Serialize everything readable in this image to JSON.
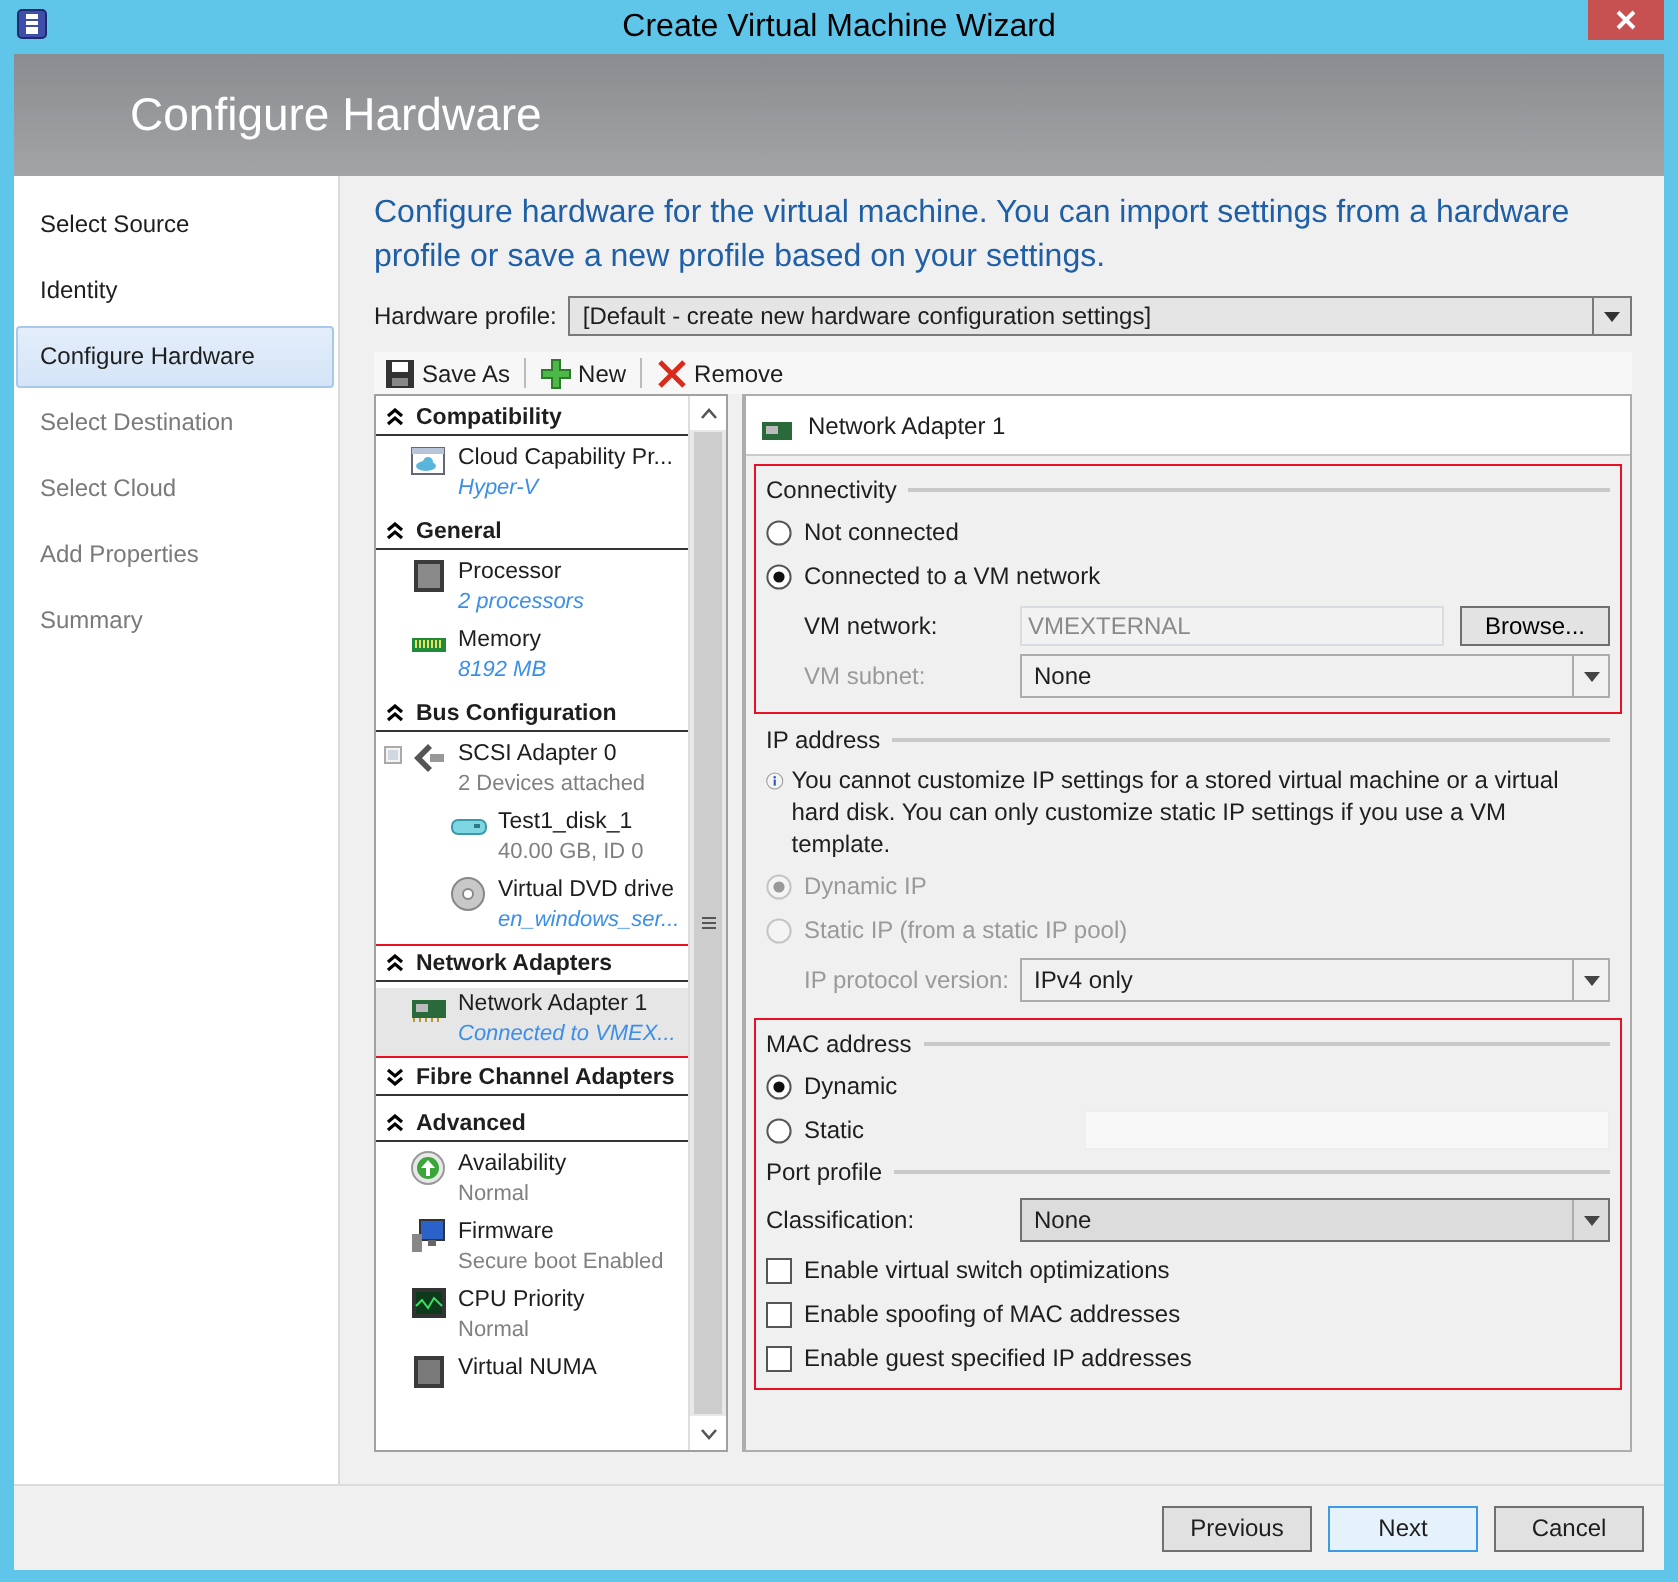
{
  "window": {
    "title": "Create Virtual Machine Wizard"
  },
  "header": {
    "title": "Configure Hardware"
  },
  "nav": {
    "items": [
      {
        "label": "Select Source",
        "selected": false,
        "disabled": false
      },
      {
        "label": "Identity",
        "selected": false,
        "disabled": false
      },
      {
        "label": "Configure Hardware",
        "selected": true,
        "disabled": false
      },
      {
        "label": "Select Destination",
        "selected": false,
        "disabled": true
      },
      {
        "label": "Select Cloud",
        "selected": false,
        "disabled": true
      },
      {
        "label": "Add Properties",
        "selected": false,
        "disabled": true
      },
      {
        "label": "Summary",
        "selected": false,
        "disabled": true
      }
    ]
  },
  "description": "Configure hardware for the virtual machine. You can import settings from a hardware profile or save a new profile based on your settings.",
  "hardware_profile": {
    "label": "Hardware profile:",
    "value": "[Default - create new hardware configuration settings]"
  },
  "toolbar": [
    {
      "kind": "save",
      "label": "Save As"
    },
    {
      "kind": "new",
      "label": "New"
    },
    {
      "kind": "remove",
      "label": "Remove"
    }
  ],
  "hardware_list": {
    "groups": [
      {
        "title": "Compatibility",
        "expanded": true,
        "items": [
          {
            "kind": "cloud",
            "name": "Cloud Capability Pr...",
            "detail": "Hyper-V",
            "detail_dim": false,
            "selected": false
          }
        ]
      },
      {
        "title": "General",
        "expanded": true,
        "items": [
          {
            "kind": "processor",
            "name": "Processor",
            "detail": "2 processors",
            "detail_dim": false,
            "selected": false
          },
          {
            "kind": "memory",
            "name": "Memory",
            "detail": "8192 MB",
            "detail_dim": false,
            "selected": false
          }
        ]
      },
      {
        "title": "Bus Configuration",
        "expanded": true,
        "items": [
          {
            "kind": "scsi",
            "name": "SCSI Adapter 0",
            "detail": "2 Devices attached",
            "detail_dim": true,
            "selected": false,
            "expanded": true,
            "children": [
              {
                "kind": "disk",
                "name": "Test1_disk_1",
                "detail": "40.00 GB, ID 0",
                "detail_dim": true,
                "selected": false
              },
              {
                "kind": "dvd",
                "name": "Virtual DVD drive",
                "detail": "en_windows_ser...",
                "detail_dim": false,
                "selected": false
              }
            ]
          }
        ]
      },
      {
        "title": "Network Adapters",
        "expanded": true,
        "highlighted": true,
        "items": [
          {
            "kind": "network",
            "name": "Network Adapter 1",
            "detail": "Connected to VMEX...",
            "detail_dim": false,
            "selected": true
          }
        ]
      },
      {
        "title": "Fibre Channel Adapters",
        "expanded": false
      },
      {
        "title": "Advanced",
        "expanded": true,
        "items": [
          {
            "kind": "availability",
            "name": "Availability",
            "detail": "Normal",
            "detail_dim": true,
            "selected": false
          },
          {
            "kind": "firmware",
            "name": "Firmware",
            "detail": "Secure boot Enabled",
            "detail_dim": true,
            "selected": false
          },
          {
            "kind": "cpu",
            "name": "CPU Priority",
            "detail": "Normal",
            "detail_dim": true,
            "selected": false
          },
          {
            "kind": "numa",
            "name": "Virtual NUMA",
            "selected": false
          }
        ]
      }
    ]
  },
  "panel": {
    "title": "Network Adapter 1",
    "blocks": [
      {
        "highlighted": true,
        "sections": [
          {
            "title": "Connectivity",
            "rows": [
              {
                "kind": "radio",
                "label": "Not connected",
                "selected": false,
                "disabled": false
              },
              {
                "kind": "radio",
                "label": "Connected to a VM network",
                "selected": true,
                "disabled": false
              },
              {
                "kind": "text",
                "label": "VM network:",
                "value": "VMEXTERNAL",
                "value_disabled": true,
                "button": "Browse..."
              },
              {
                "kind": "select",
                "label": "VM subnet:",
                "label_disabled": true,
                "value": "None"
              }
            ]
          }
        ]
      },
      {
        "sections": [
          {
            "title": "IP address",
            "rows": [
              {
                "kind": "info",
                "text": "You cannot customize IP settings for a stored virtual machine or a virtual hard disk. You can only customize static IP settings if you use a VM template."
              },
              {
                "kind": "radio",
                "label": "Dynamic IP",
                "selected": true,
                "disabled": true
              },
              {
                "kind": "radio",
                "label": "Static IP (from a static IP pool)",
                "selected": false,
                "disabled": true
              },
              {
                "kind": "select",
                "label": "IP protocol version:",
                "label_disabled": true,
                "value": "IPv4 only"
              }
            ]
          }
        ]
      },
      {
        "highlighted": true,
        "sections": [
          {
            "title": "MAC address",
            "rows": [
              {
                "kind": "radio",
                "label": "Dynamic",
                "selected": true,
                "disabled": false
              },
              {
                "kind": "radio",
                "label": "Static",
                "selected": false,
                "disabled": false,
                "field": true
              }
            ]
          },
          {
            "title": "Port profile",
            "rows": [
              {
                "kind": "select",
                "label": "Classification:",
                "label_disabled": false,
                "value": "None"
              },
              {
                "kind": "checkbox",
                "label": "Enable virtual switch optimizations",
                "checked": false
              },
              {
                "kind": "checkbox",
                "label": "Enable spoofing of MAC addresses",
                "checked": false
              },
              {
                "kind": "checkbox",
                "label": "Enable guest specified IP addresses",
                "checked": false
              }
            ]
          }
        ]
      }
    ]
  },
  "footer": {
    "buttons": [
      {
        "label": "Previous",
        "default": false
      },
      {
        "label": "Next",
        "default": true
      },
      {
        "label": "Cancel",
        "default": false
      }
    ]
  }
}
